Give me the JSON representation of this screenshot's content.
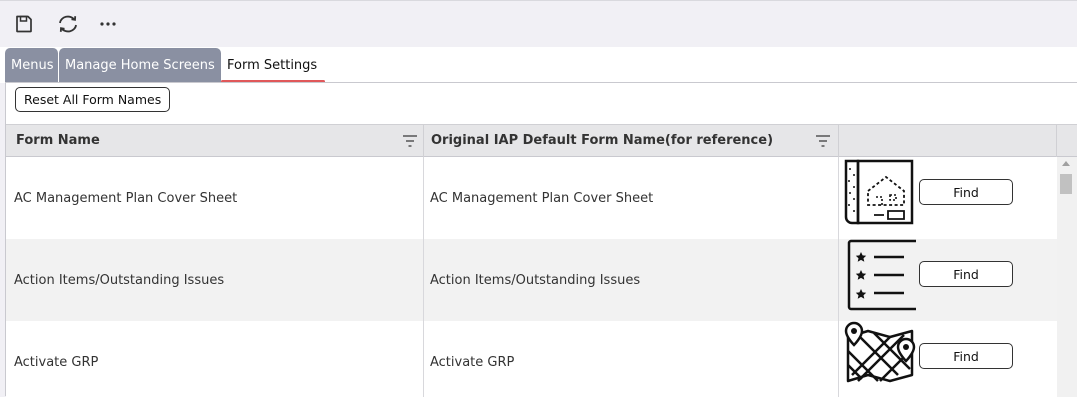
{
  "toolbar": {
    "icons": [
      "save-icon",
      "refresh-icon",
      "more-icon"
    ]
  },
  "tabs": [
    {
      "label": "Menus",
      "active": false
    },
    {
      "label": "Manage Home Screens",
      "active": false
    },
    {
      "label": "Form Settings",
      "active": true
    }
  ],
  "panel": {
    "reset_label": "Reset All Form Names"
  },
  "grid": {
    "columns": [
      "Form Name",
      "Original IAP Default Form Name(for reference)",
      ""
    ],
    "rows": [
      {
        "form_name": "AC Management Plan Cover Sheet",
        "original_name": "AC Management Plan Cover Sheet",
        "icon": "blueprint-icon",
        "action": "Find"
      },
      {
        "form_name": "Action Items/Outstanding Issues",
        "original_name": "Action Items/Outstanding Issues",
        "icon": "checklist-icon",
        "action": "Find"
      },
      {
        "form_name": "Activate GRP",
        "original_name": "Activate GRP",
        "icon": "map-icon",
        "action": "Find"
      }
    ]
  },
  "colors": {
    "tab_inactive_bg": "#8a90a2",
    "tab_active_underline": "#e0585a",
    "header_bg": "#e6e6e8",
    "row_alt_bg": "#f2f2f2"
  }
}
